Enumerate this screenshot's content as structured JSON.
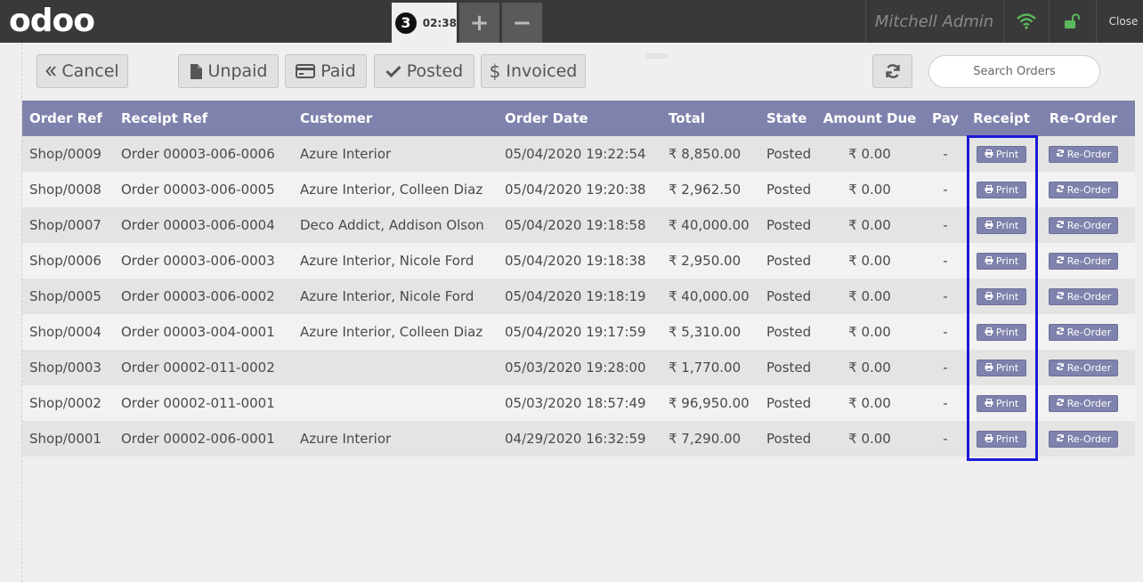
{
  "topbar": {
    "logo": "odoo",
    "order_tab": {
      "sequence": "3",
      "time": "02:38"
    },
    "add_label": "+",
    "remove_label": "−",
    "username": "Mitchell Admin",
    "close_label": "Close",
    "colors": {
      "wifi": "#5cb85c",
      "lock": "#5cb85c"
    }
  },
  "controls": {
    "cancel_label": "Cancel",
    "unpaid_label": "Unpaid",
    "paid_label": "Paid",
    "posted_label": "Posted",
    "invoiced_label": "Invoiced",
    "search_placeholder": "Search Orders"
  },
  "table": {
    "headers": {
      "order_ref": "Order Ref",
      "receipt_ref": "Receipt Ref",
      "customer": "Customer",
      "order_date": "Order Date",
      "total": "Total",
      "state": "State",
      "amount_due": "Amount Due",
      "pay": "Pay",
      "receipt": "Receipt",
      "reorder": "Re-Order"
    },
    "print_label": "Print",
    "reorder_label": "Re-Order",
    "rows": [
      {
        "order_ref": "Shop/0009",
        "receipt_ref": "Order 00003-006-0006",
        "customer": "Azure Interior",
        "order_date": "05/04/2020 19:22:54",
        "total": "₹ 8,850.00",
        "state": "Posted",
        "amount_due": "₹ 0.00",
        "pay": "-"
      },
      {
        "order_ref": "Shop/0008",
        "receipt_ref": "Order 00003-006-0005",
        "customer": "Azure Interior, Colleen Diaz",
        "order_date": "05/04/2020 19:20:38",
        "total": "₹ 2,962.50",
        "state": "Posted",
        "amount_due": "₹ 0.00",
        "pay": "-"
      },
      {
        "order_ref": "Shop/0007",
        "receipt_ref": "Order 00003-006-0004",
        "customer": "Deco Addict, Addison Olson",
        "order_date": "05/04/2020 19:18:58",
        "total": "₹ 40,000.00",
        "state": "Posted",
        "amount_due": "₹ 0.00",
        "pay": "-"
      },
      {
        "order_ref": "Shop/0006",
        "receipt_ref": "Order 00003-006-0003",
        "customer": "Azure Interior, Nicole Ford",
        "order_date": "05/04/2020 19:18:38",
        "total": "₹ 2,950.00",
        "state": "Posted",
        "amount_due": "₹ 0.00",
        "pay": "-"
      },
      {
        "order_ref": "Shop/0005",
        "receipt_ref": "Order 00003-006-0002",
        "customer": "Azure Interior, Nicole Ford",
        "order_date": "05/04/2020 19:18:19",
        "total": "₹ 40,000.00",
        "state": "Posted",
        "amount_due": "₹ 0.00",
        "pay": "-"
      },
      {
        "order_ref": "Shop/0004",
        "receipt_ref": "Order 00003-004-0001",
        "customer": "Azure Interior, Colleen Diaz",
        "order_date": "05/04/2020 19:17:59",
        "total": "₹ 5,310.00",
        "state": "Posted",
        "amount_due": "₹ 0.00",
        "pay": "-"
      },
      {
        "order_ref": "Shop/0003",
        "receipt_ref": "Order 00002-011-0002",
        "customer": "",
        "order_date": "05/03/2020 19:28:00",
        "total": "₹ 1,770.00",
        "state": "Posted",
        "amount_due": "₹ 0.00",
        "pay": "-"
      },
      {
        "order_ref": "Shop/0002",
        "receipt_ref": "Order 00002-011-0001",
        "customer": "",
        "order_date": "05/03/2020 18:57:49",
        "total": "₹ 96,950.00",
        "state": "Posted",
        "amount_due": "₹ 0.00",
        "pay": "-"
      },
      {
        "order_ref": "Shop/0001",
        "receipt_ref": "Order 00002-006-0001",
        "customer": "Azure Interior",
        "order_date": "04/29/2020 16:32:59",
        "total": "₹ 7,290.00",
        "state": "Posted",
        "amount_due": "₹ 0.00",
        "pay": "-"
      }
    ]
  },
  "highlight_color": "#1a1ad6"
}
